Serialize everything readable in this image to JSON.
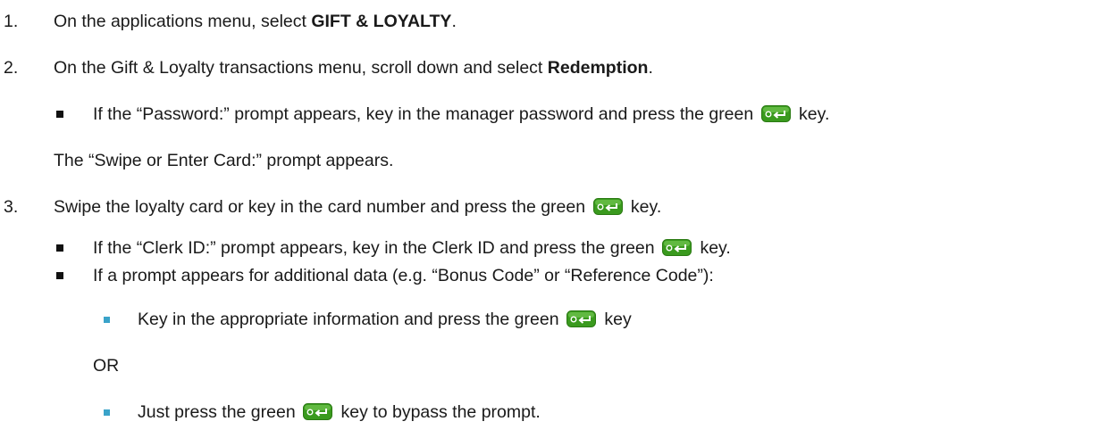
{
  "doc": {
    "key_icon": "green-enter-key-icon",
    "key_color": "#3a9a1e",
    "bullet2_color": "#3aa3c9",
    "steps": [
      {
        "num": "1.",
        "pre": "On the applications menu, select ",
        "bold": "GIFT & LOYALTY",
        "post": "."
      },
      {
        "num": "2.",
        "pre": "On the Gift & Loyalty transactions menu, scroll down and select ",
        "bold": "Redemption",
        "post": ".",
        "bullet": {
          "pre": "If the “Password:” prompt appears, key in the manager password and press the green ",
          "post": " key."
        },
        "note": "The “Swipe or Enter Card:” prompt appears."
      },
      {
        "num": "3.",
        "pre": "Swipe the loyalty card or key in the card number and press the green ",
        "post": " key.",
        "bullet1": {
          "pre": "If the “Clerk ID:” prompt appears, key in the Clerk ID and press the green ",
          "post": " key."
        },
        "bullet2": "If a prompt appears for additional data (e.g. “Bonus Code” or “Reference Code”):",
        "sub1": {
          "pre": "Key in the appropriate information and press the green ",
          "post": " key"
        },
        "or": "OR",
        "sub2": {
          "pre": "Just press the green ",
          "post": " key to bypass the prompt."
        }
      }
    ]
  }
}
